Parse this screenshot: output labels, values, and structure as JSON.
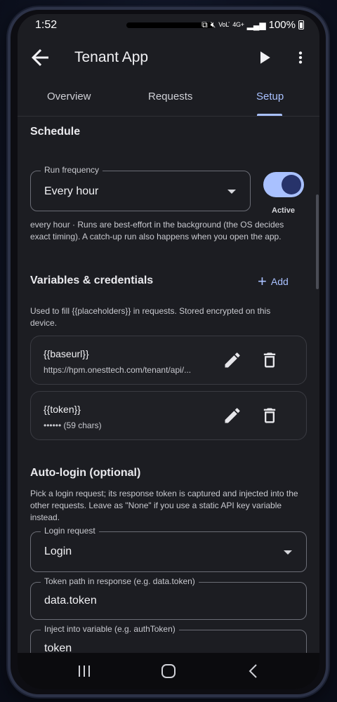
{
  "status_bar": {
    "time": "1:52",
    "signal_text": "4G+",
    "volte_text": "VoLTE",
    "battery_percent": "100%"
  },
  "app_bar": {
    "title": "Tenant App",
    "icons": [
      "back-arrow-icon",
      "play-icon",
      "more-vert-icon"
    ]
  },
  "tabs": [
    {
      "label": "Overview",
      "active": false
    },
    {
      "label": "Requests",
      "active": false
    },
    {
      "label": "Setup",
      "active": true
    }
  ],
  "schedule": {
    "title": "Schedule",
    "run_frequency_label": "Run frequency",
    "run_frequency_value": "Every hour",
    "active_label": "Active",
    "active_on": true,
    "note": "every hour · Runs are best-effort in the background (the OS decides exact timing). A catch-up run also happens when you open the app."
  },
  "variables": {
    "title": "Variables & credentials",
    "add_label": "Add",
    "description": "Used to fill {{placeholders}} in requests. Stored encrypted on this device.",
    "items": [
      {
        "name": "{{baseurl}}",
        "value": "https://hpm.onesttech.com/tenant/api/..."
      },
      {
        "name": "{{token}}",
        "value": "•••••• (59 chars)"
      }
    ]
  },
  "auto_login": {
    "title": "Auto-login (optional)",
    "description": "Pick a login request; its response token is captured and injected into the other requests. Leave as \"None\" if you use a static API key variable instead.",
    "login_request_label": "Login request",
    "login_request_value": "Login",
    "token_path_label": "Token path in response (e.g. data.token)",
    "token_path_value": "data.token",
    "inject_label": "Inject into variable (e.g. authToken)",
    "inject_value": "token"
  },
  "nav_bar": {
    "icons": [
      "recents-icon",
      "home-icon",
      "back-icon"
    ]
  },
  "colors": {
    "accent": "#a9c1ff",
    "background": "#1c1d22",
    "thumb": "#27336a"
  }
}
